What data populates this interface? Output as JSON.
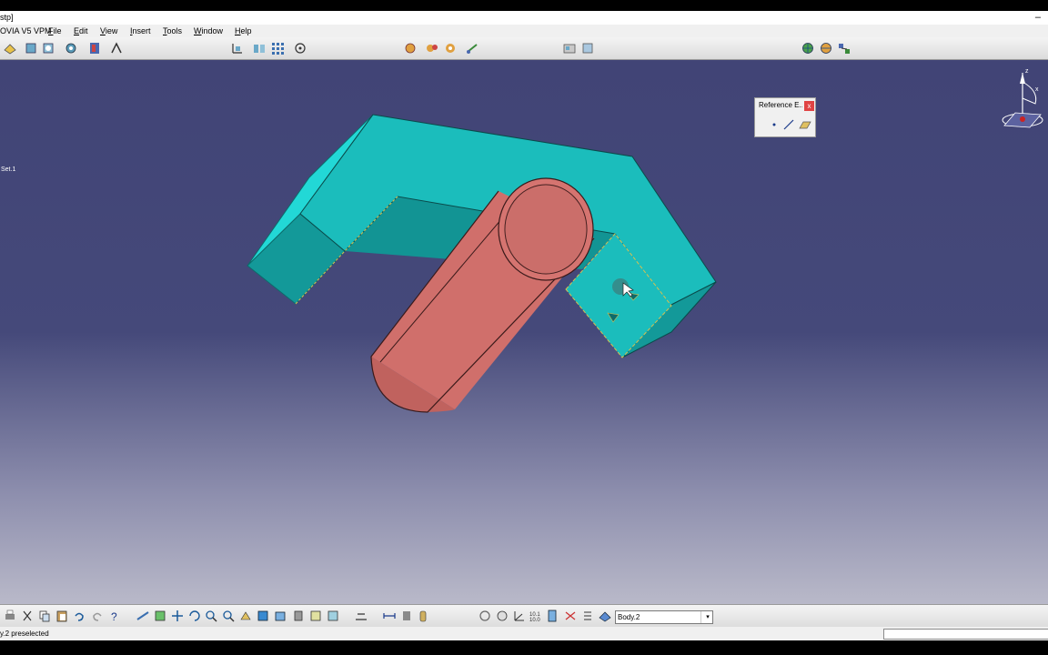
{
  "window": {
    "title": "stp]",
    "minimize_glyph": "–"
  },
  "menubar": {
    "app_name": "OVIA V5 VPM",
    "items": [
      "File",
      "Edit",
      "View",
      "Insert",
      "Tools",
      "Window",
      "Help"
    ]
  },
  "toolbar_top": {
    "icons": [
      "sketcher-icon",
      "shape-icon",
      "shape2-icon",
      "gear-icon",
      "book-icon",
      "snap-icon",
      "axis-icon",
      "part-icon",
      "grid-icon",
      "target-icon",
      "assembly-icon",
      "assembly2-icon",
      "assembly3-icon",
      "link-icon",
      "measure-icon",
      "compass-box-icon",
      "globe-icon",
      "globe2-icon",
      "network-icon"
    ]
  },
  "tree": {
    "item_label": "Set.1"
  },
  "reference_panel": {
    "title": "Reference E...",
    "close_glyph": "x",
    "tools": [
      "point-icon",
      "line-icon",
      "plane-icon"
    ]
  },
  "colors": {
    "part_cyan": "#1bbdbc",
    "part_cyan_dark": "#139999",
    "tube_pink": "#e07a76",
    "tube_dark": "#8a4a48",
    "viewport_top": "#414476",
    "viewport_bottom": "#b9b9c9"
  },
  "toolbar_bottom": {
    "icons": [
      "print-icon",
      "cut-icon",
      "copy-icon",
      "paste-icon",
      "undo-icon",
      "redo-icon",
      "help-icon",
      "fly-icon",
      "fit-icon",
      "pan-icon",
      "rotate-icon",
      "zoom-in-icon",
      "zoom-out-icon",
      "normal-view-icon",
      "iso-view-icon",
      "shading-icon",
      "hide-icon",
      "swap-icon",
      "cut-view-icon",
      "measure-between-icon",
      "measure-item-icon",
      "inertia-icon",
      "update-icon",
      "hand-icon",
      "axis-system-icon",
      "table-icon",
      "cube-icon",
      "constraint-icon",
      "list-icon",
      "body-icon"
    ],
    "body_select": {
      "value": "Body.2",
      "arrow": "▾"
    }
  },
  "statusbar": {
    "message": "y.2 preselected"
  }
}
